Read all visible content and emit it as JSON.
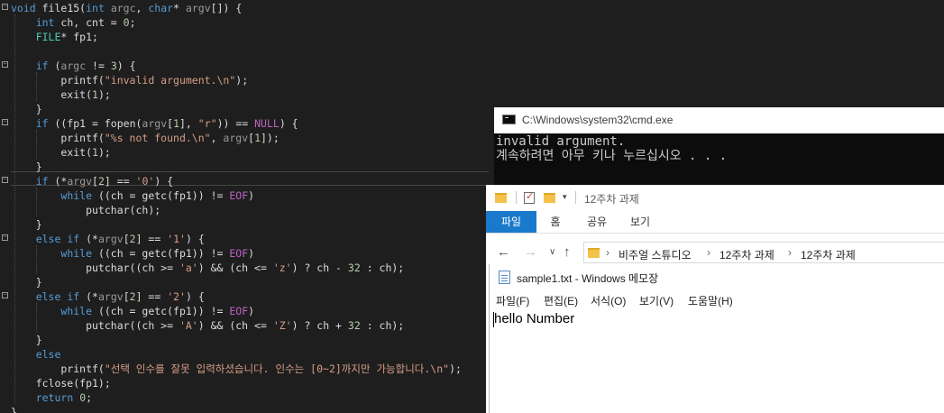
{
  "editor": {
    "lines": [
      "void file15(int argc, char* argv[]) {",
      "    int ch, cnt = 0;",
      "    FILE* fp1;",
      "",
      "    if (argc != 3) {",
      "        printf(\"invalid argument.\\n\");",
      "        exit(1);",
      "    }",
      "    if ((fp1 = fopen(argv[1], \"r\")) == NULL) {",
      "        printf(\"%s not found.\\n\", argv[1]);",
      "        exit(1);",
      "    }",
      "    if (*argv[2] == '0') {",
      "        while ((ch = getc(fp1)) != EOF)",
      "            putchar(ch);",
      "    }",
      "    else if (*argv[2] == '1') {",
      "        while ((ch = getc(fp1)) != EOF)",
      "            putchar((ch >= 'a') && (ch <= 'z') ? ch - 32 : ch);",
      "    }",
      "    else if (*argv[2] == '2') {",
      "        while ((ch = getc(fp1)) != EOF)",
      "            putchar((ch >= 'A') && (ch <= 'Z') ? ch + 32 : ch);",
      "    }",
      "    else",
      "        printf(\"선택 인수를 잘못 입력하셨습니다. 인수는 [0~2]까지만 가능합니다.\\n\");",
      "    fclose(fp1);",
      "    return 0;",
      "}"
    ]
  },
  "cmd": {
    "title": "C:\\Windows\\system32\\cmd.exe",
    "output": [
      "invalid argument.",
      "계속하려면 아무 키나 누르십시오 . . ."
    ]
  },
  "explorer": {
    "quick_access_title": "12주차 과제",
    "tabs": [
      "파일",
      "홈",
      "공유",
      "보기"
    ],
    "breadcrumb": [
      "비주얼 스튜디오",
      "12주차 과제",
      "12주차 과제"
    ]
  },
  "notepad": {
    "title": "sample1.txt - Windows 메모장",
    "menu": [
      "파일(F)",
      "편집(E)",
      "서식(O)",
      "보기(V)",
      "도움말(H)"
    ],
    "content": "hello Number"
  },
  "colors": {
    "editor_bg": "#1e1e1e",
    "keyword": "#569cd6",
    "string": "#d69d85",
    "ribbon_file_tab": "#1979ca",
    "cmd_bg": "#0c0c0c"
  }
}
